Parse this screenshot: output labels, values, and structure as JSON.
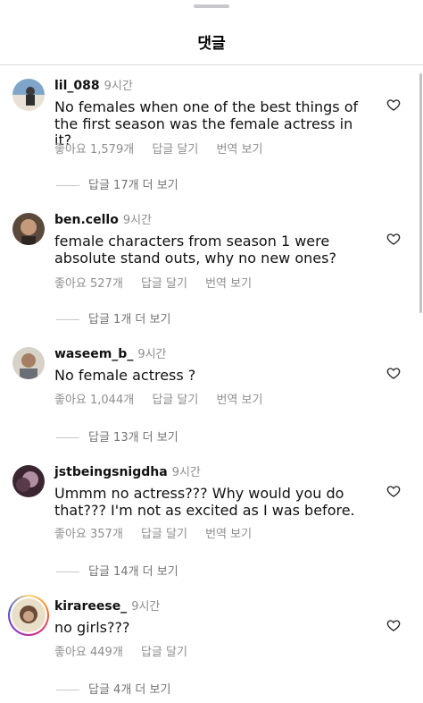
{
  "header": {
    "title": "댓글"
  },
  "actions": {
    "like_prefix": "좋아요",
    "reply": "답글 달기",
    "translate": "번역 보기"
  },
  "comments": [
    {
      "username": "lil_088",
      "time": "9시간",
      "text": "No females when one of the best things of the first season was the female actress in it?",
      "likes": "좋아요 1,579개",
      "replies": "답글 17개 더 보기",
      "avatar_colors": [
        "#7fa6c9",
        "#e8e1d6"
      ]
    },
    {
      "username": "ben.cello",
      "time": "9시간",
      "text": "female characters from season 1 were absolute stand outs, why no new ones?",
      "likes": "좋아요 527개",
      "replies": "답글 1개 더 보기",
      "avatar_colors": [
        "#5b4a3c",
        "#c49a7b"
      ]
    },
    {
      "username": "waseem_b_",
      "time": "9시간",
      "text": "No female actress ?",
      "likes": "좋아요 1,044개",
      "replies": "답글 13개 더 보기",
      "avatar_colors": [
        "#d7d2c8",
        "#a47f63"
      ]
    },
    {
      "username": "jstbeingsnigdha",
      "time": "9시간",
      "text": "Ummm no actress??? Why would you do that??? I'm not as excited as I was before.",
      "likes": "좋아요 357개",
      "replies": "답글 14개 더 보기",
      "avatar_colors": [
        "#3a2530",
        "#b08fa2"
      ]
    },
    {
      "username": "kirareese_",
      "time": "9시간",
      "text": "no girls???",
      "likes": "좋아요 449개",
      "replies": "답글 4개 더 보기",
      "avatar_colors": [
        "#e9dfc9",
        "#6b4b37"
      ]
    }
  ]
}
